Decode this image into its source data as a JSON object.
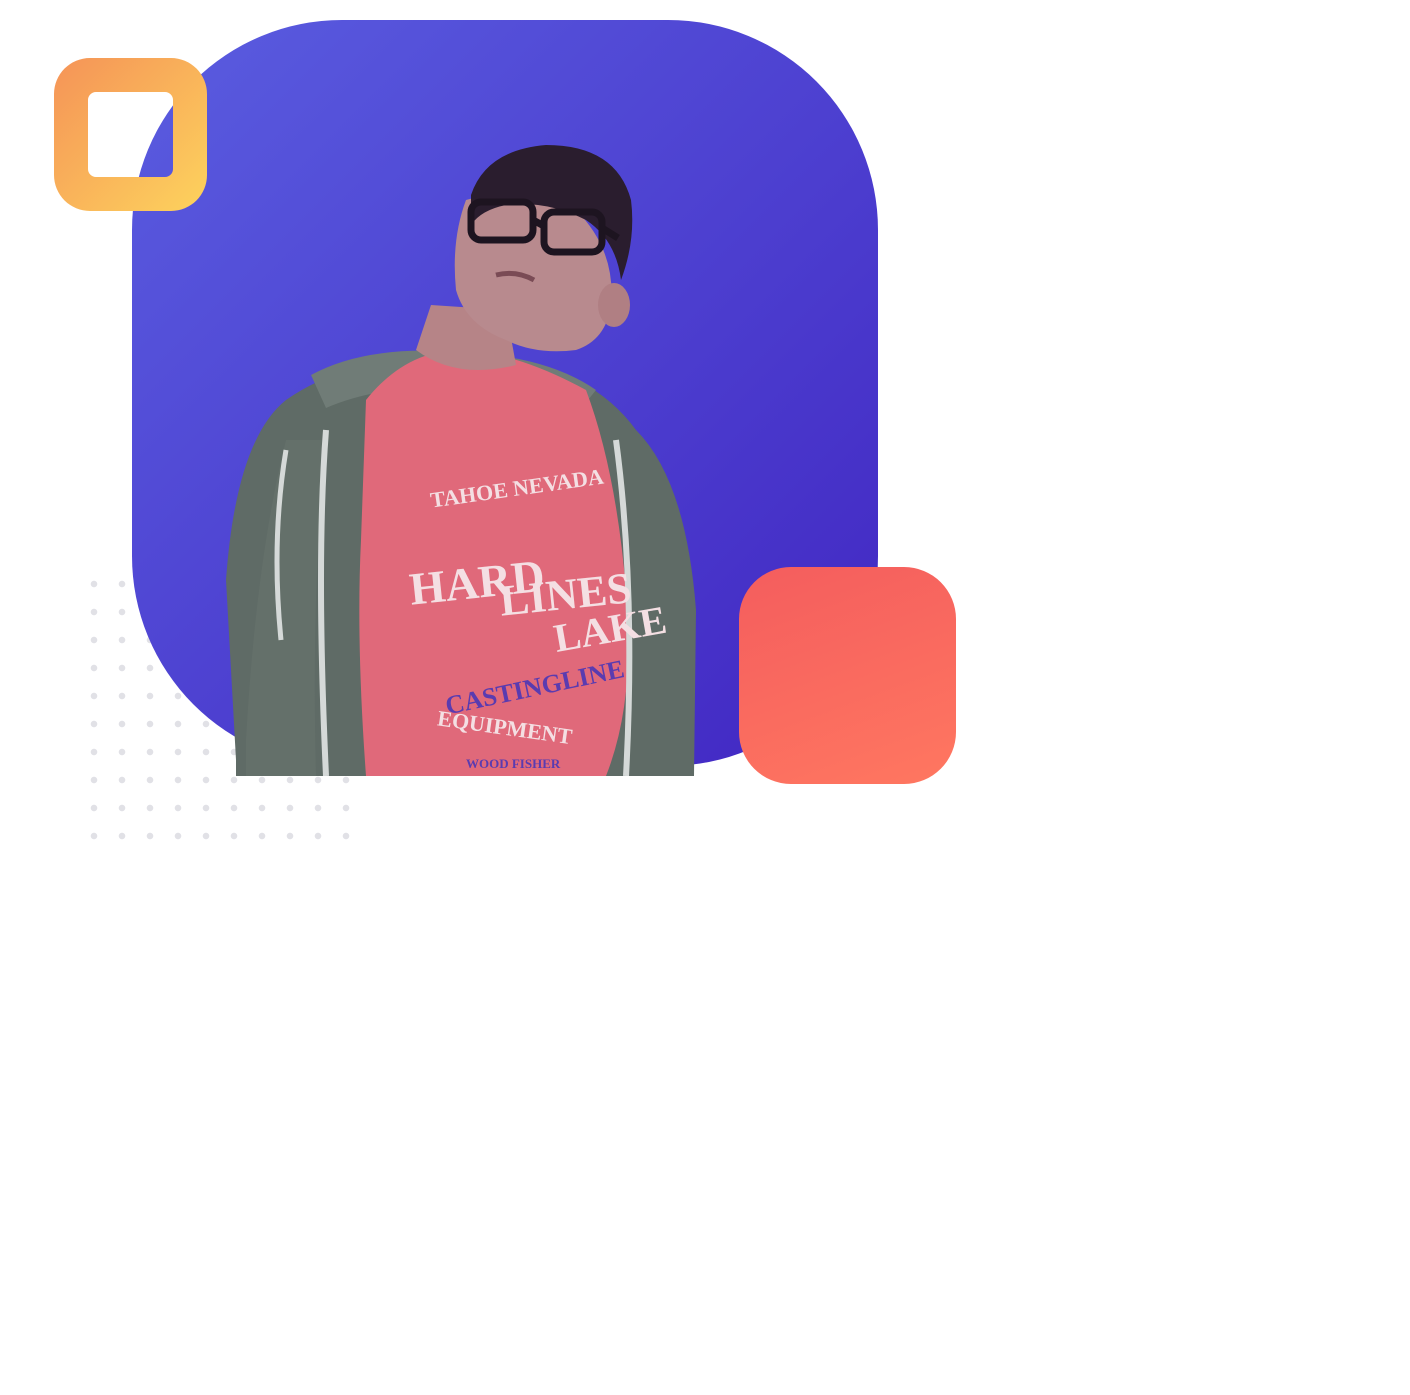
{
  "colors": {
    "background": "#ffffff",
    "card_gradient_start": "#5a5de0",
    "card_gradient_end": "#4126c2",
    "frame_gradient_start": "#f59357",
    "frame_gradient_end": "#fdd35d",
    "coral_start": "#f45d5e",
    "coral_end": "#ff7760",
    "dot_color": "#e1e1e6",
    "jacket": "#5f6b66",
    "tshirt": "#e0697a",
    "skin": "#b88a8e",
    "hair": "#2a1d2e"
  },
  "shirt_print": {
    "line1": "TAHOE NEVADA",
    "line2": "HARD",
    "line3": "LINES",
    "line4": "LAKE",
    "line5": "CASTINGLINE",
    "line6": "EQUIPMENT",
    "line7": "WOOD FISHER"
  },
  "icons": {
    "frame_icon": "rounded-square-outline-icon",
    "dots": "dot-grid-pattern"
  }
}
